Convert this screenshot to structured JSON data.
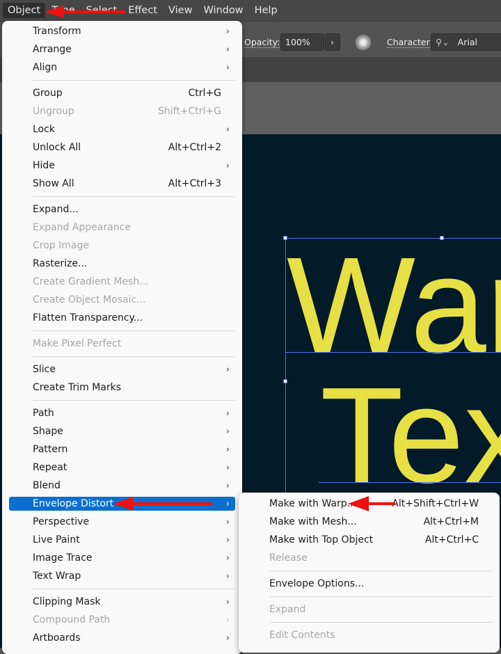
{
  "menubar": [
    "Object",
    "Type",
    "Select",
    "Effect",
    "View",
    "Window",
    "Help"
  ],
  "toolbar": {
    "opacity_label": "Opacity:",
    "opacity_value": "100%",
    "character_label": "Character:",
    "font_value": "Arial"
  },
  "canvas": {
    "line1": "War",
    "line2": "Tex",
    "text_color": "#e6e045"
  },
  "object_menu": [
    {
      "label": "Transform",
      "submenu": true
    },
    {
      "label": "Arrange",
      "submenu": true
    },
    {
      "label": "Align",
      "submenu": true
    },
    {
      "sep": true
    },
    {
      "label": "Group",
      "shortcut": "Ctrl+G"
    },
    {
      "label": "Ungroup",
      "shortcut": "Shift+Ctrl+G",
      "disabled": true
    },
    {
      "label": "Lock",
      "submenu": true
    },
    {
      "label": "Unlock All",
      "shortcut": "Alt+Ctrl+2"
    },
    {
      "label": "Hide",
      "submenu": true
    },
    {
      "label": "Show All",
      "shortcut": "Alt+Ctrl+3"
    },
    {
      "sep": true
    },
    {
      "label": "Expand..."
    },
    {
      "label": "Expand Appearance",
      "disabled": true
    },
    {
      "label": "Crop Image",
      "disabled": true
    },
    {
      "label": "Rasterize..."
    },
    {
      "label": "Create Gradient Mesh...",
      "disabled": true
    },
    {
      "label": "Create Object Mosaic...",
      "disabled": true
    },
    {
      "label": "Flatten Transparency..."
    },
    {
      "sep": true
    },
    {
      "label": "Make Pixel Perfect",
      "disabled": true
    },
    {
      "sep": true
    },
    {
      "label": "Slice",
      "submenu": true
    },
    {
      "label": "Create Trim Marks"
    },
    {
      "sep": true
    },
    {
      "label": "Path",
      "submenu": true
    },
    {
      "label": "Shape",
      "submenu": true
    },
    {
      "label": "Pattern",
      "submenu": true
    },
    {
      "label": "Repeat",
      "submenu": true
    },
    {
      "label": "Blend",
      "submenu": true
    },
    {
      "label": "Envelope Distort",
      "submenu": true,
      "highlighted": true
    },
    {
      "label": "Perspective",
      "submenu": true
    },
    {
      "label": "Live Paint",
      "submenu": true
    },
    {
      "label": "Image Trace",
      "submenu": true
    },
    {
      "label": "Text Wrap",
      "submenu": true
    },
    {
      "sep": true
    },
    {
      "label": "Clipping Mask",
      "submenu": true
    },
    {
      "label": "Compound Path",
      "submenu": true,
      "disabled": true
    },
    {
      "label": "Artboards",
      "submenu": true
    }
  ],
  "envelope_submenu": [
    {
      "label": "Make with Warp...",
      "shortcut": "Alt+Shift+Ctrl+W"
    },
    {
      "label": "Make with Mesh...",
      "shortcut": "Alt+Ctrl+M"
    },
    {
      "label": "Make with Top Object",
      "shortcut": "Alt+Ctrl+C"
    },
    {
      "label": "Release",
      "disabled": true
    },
    {
      "sep": true
    },
    {
      "label": "Envelope Options..."
    },
    {
      "sep": true
    },
    {
      "label": "Expand",
      "disabled": true
    },
    {
      "sep": true
    },
    {
      "label": "Edit Contents",
      "disabled": true
    }
  ],
  "colors": {
    "highlight": "#0b6fcf",
    "annotation_arrow": "#ee1111"
  }
}
